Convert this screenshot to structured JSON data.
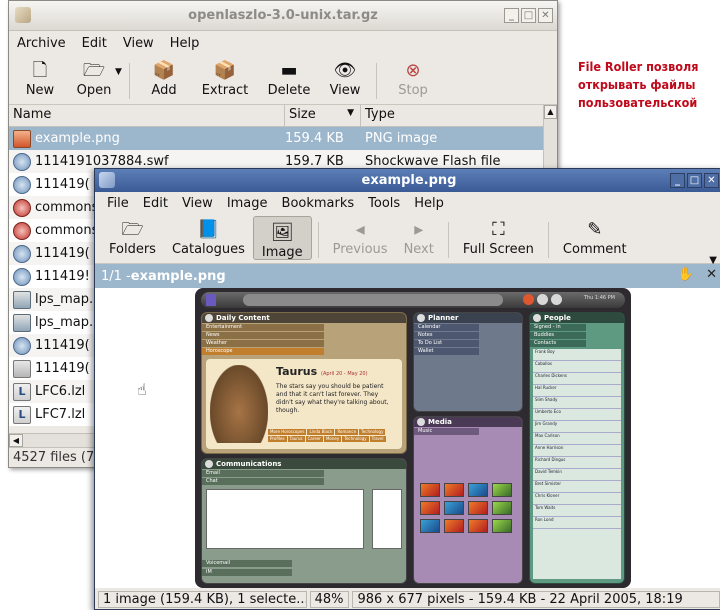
{
  "file_roller": {
    "title": "openlaszlo-3.0-unix.tar.gz",
    "menu": [
      "Archive",
      "Edit",
      "View",
      "Help"
    ],
    "toolbar": {
      "new": "New",
      "open": "Open",
      "add": "Add",
      "extract": "Extract",
      "delete": "Delete",
      "view": "View",
      "stop": "Stop"
    },
    "columns": {
      "name": "Name",
      "size": "Size",
      "type": "Type"
    },
    "rows": [
      {
        "name": "example.png",
        "size": "159.4 KB",
        "type": "PNG image",
        "icon": "png-file-icon"
      },
      {
        "name": "1114191037884.swf",
        "size": "159.7 KB",
        "type": "Shockwave Flash file",
        "icon": "swf-file-icon"
      },
      {
        "name": "111419(",
        "size": "",
        "type": "",
        "icon": "swf-file-icon"
      },
      {
        "name": "commons",
        "size": "",
        "type": "",
        "icon": "deb-file-icon"
      },
      {
        "name": "commons",
        "size": "",
        "type": "",
        "icon": "deb-file-icon"
      },
      {
        "name": "111419(",
        "size": "",
        "type": "",
        "icon": "swf-file-icon"
      },
      {
        "name": "111419!",
        "size": "",
        "type": "",
        "icon": "swf-file-icon"
      },
      {
        "name": "lps_map.",
        "size": "",
        "type": "",
        "icon": "map-file-icon"
      },
      {
        "name": "lps_map.",
        "size": "",
        "type": "",
        "icon": "map-file-icon"
      },
      {
        "name": "111419(",
        "size": "",
        "type": "",
        "icon": "swf-file-icon"
      },
      {
        "name": "111419(",
        "size": "",
        "type": "",
        "icon": "zip-file-icon"
      },
      {
        "name": "LFC6.lzl",
        "size": "",
        "type": "",
        "icon": "lzl-file-icon"
      },
      {
        "name": "LFC7.lzl",
        "size": "",
        "type": "",
        "icon": "lzl-file-icon"
      }
    ],
    "status": "4527 files (7("
  },
  "caption": {
    "line1": "File Roller позволя",
    "line2": "открывать файлы",
    "line3": "пользовательской"
  },
  "viewer": {
    "title": "example.png",
    "menu": [
      "File",
      "Edit",
      "View",
      "Image",
      "Bookmarks",
      "Tools",
      "Help"
    ],
    "toolbar": {
      "folders": "Folders",
      "catalogues": "Catalogues",
      "image": "Image",
      "previous": "Previous",
      "next": "Next",
      "fullscreen": "Full Screen",
      "comment": "Comment"
    },
    "location": {
      "counter": "1/1 - ",
      "filename": "example.png"
    },
    "status": {
      "images": "1 image (159.4 KB), 1 selecte...",
      "zoom": "48%",
      "details": "986 x 677 pixels - 159.4 KB - 22 April 2005, 18:19"
    }
  },
  "mockup": {
    "clock": "Thu 1:46 PM",
    "daily": {
      "title": "Daily Content",
      "tabs": [
        "Entertainment",
        "News",
        "Weather",
        "Horoscope"
      ],
      "sign": "Taurus",
      "dates": "(April 20 - May 20)",
      "text": "The stars say you should be patient and that it can't last forever. They didn't say what they're talking about, though.",
      "links": [
        "More Horoscopes",
        "Linda Black",
        "Romance",
        "Technology",
        "Profiles",
        "Taurus",
        "Career",
        "Money",
        "Technology",
        "Travel"
      ]
    },
    "planner": {
      "title": "Planner",
      "tabs": [
        "Calendar",
        "Notes",
        "To Do List",
        "Wallet"
      ]
    },
    "media": {
      "title": "Media",
      "tabs": [
        "Music"
      ]
    },
    "people": {
      "title": "People",
      "tabs": [
        "Signed - in",
        "Buddies",
        "Contacts"
      ],
      "list": [
        "Frank Boy",
        "Caballos",
        "Charles Dickens",
        "Hal Rucker",
        "Slim Shady",
        "Umberto Eco",
        "Jim Grandy",
        "Max Carlson",
        "Anne Harrison",
        "Richard Dingus",
        "David Temkin",
        "Bret Simister",
        "Chris Kloner",
        "Tom Waits",
        "Ron Lond"
      ]
    },
    "comm": {
      "title": "Communications",
      "tabs": [
        "Email",
        "Chat"
      ],
      "footer": [
        "Voicemail",
        "IM"
      ]
    }
  }
}
